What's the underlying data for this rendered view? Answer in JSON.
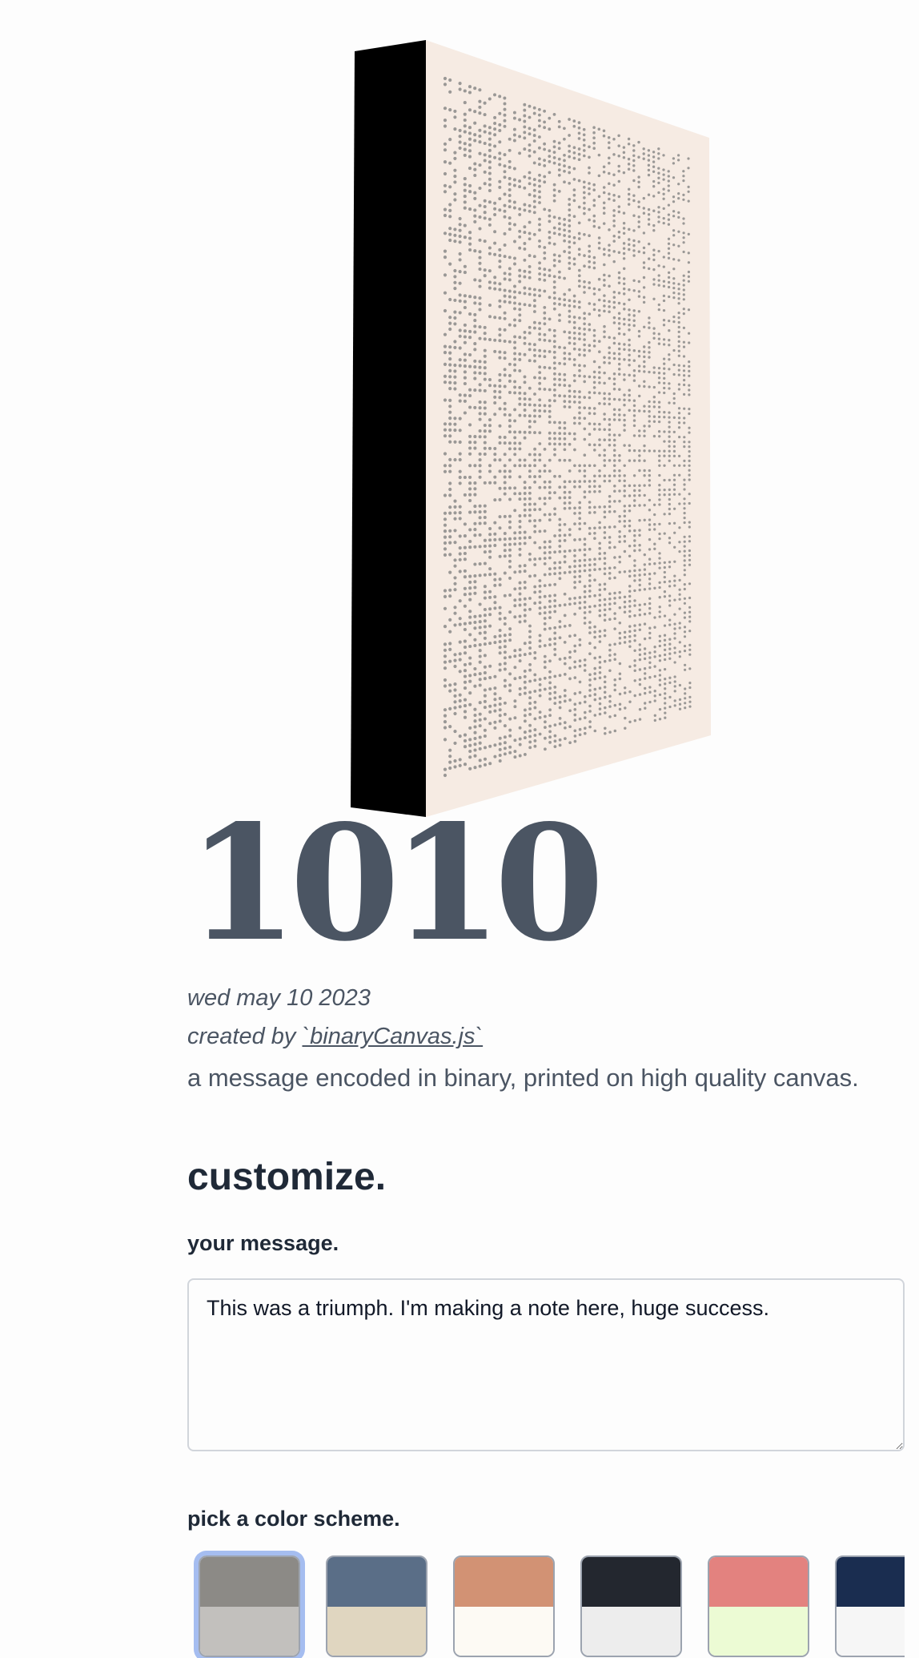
{
  "artwork": {
    "front_color": "#f6ebe3",
    "side_color": "#000000",
    "dot_color": "#9a9896"
  },
  "product": {
    "title": "1010",
    "date": "wed may 10 2023",
    "credit_prefix": "created by",
    "credit_link": "`binaryCanvas.js`",
    "description": "a message encoded in binary, printed on high quality canvas."
  },
  "customize": {
    "heading": "customize.",
    "message_label": "your message.",
    "message_value": "This was a triumph. I'm making a note here, huge success.",
    "scheme_label": "pick a color scheme.",
    "schemes": [
      {
        "top": "#8c8a86",
        "bottom": "#c2c0bd",
        "selected": true
      },
      {
        "top": "#5a6e87",
        "bottom": "#e0d6c0",
        "selected": false
      },
      {
        "top": "#d29274",
        "bottom": "#fdfaf4",
        "selected": false
      },
      {
        "top": "#23272f",
        "bottom": "#ededed",
        "selected": false
      },
      {
        "top": "#e3827f",
        "bottom": "#ecfbd4",
        "selected": false
      },
      {
        "top": "#1a2d50",
        "bottom": "#f6f6f6",
        "selected": false
      }
    ]
  }
}
